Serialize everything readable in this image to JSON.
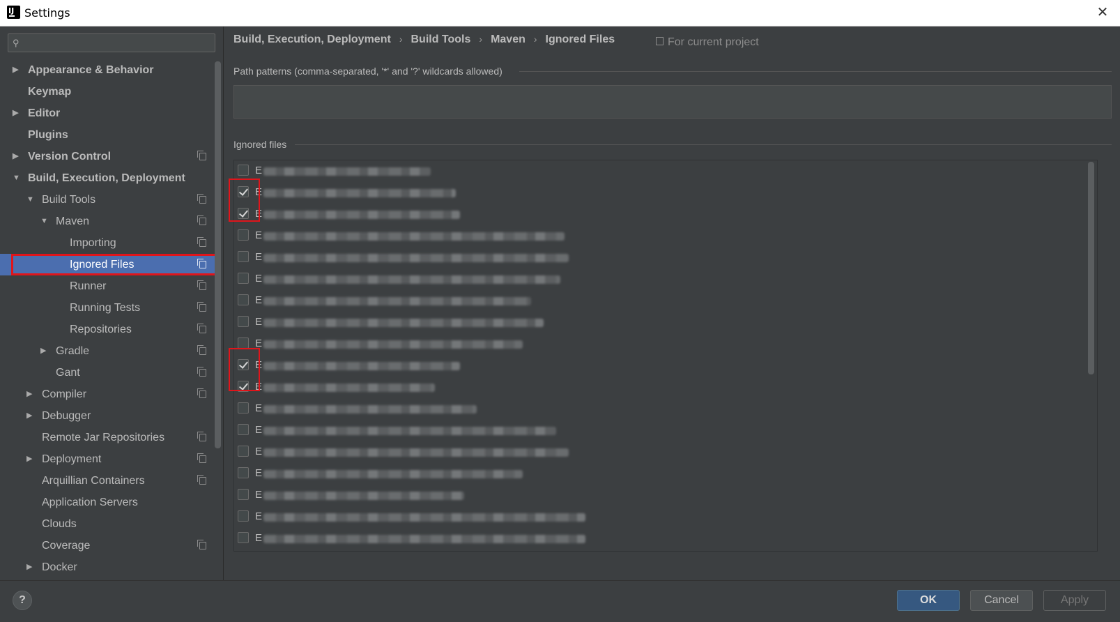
{
  "window": {
    "title": "Settings"
  },
  "search": {
    "placeholder": "",
    "value": ""
  },
  "sidebar": {
    "items": [
      {
        "label": "Appearance & Behavior",
        "level": 0,
        "arrow": "right",
        "bold": true,
        "project": false
      },
      {
        "label": "Keymap",
        "level": 0,
        "arrow": "",
        "bold": true,
        "project": false
      },
      {
        "label": "Editor",
        "level": 0,
        "arrow": "right",
        "bold": true,
        "project": false
      },
      {
        "label": "Plugins",
        "level": 0,
        "arrow": "",
        "bold": true,
        "project": false
      },
      {
        "label": "Version Control",
        "level": 0,
        "arrow": "right",
        "bold": true,
        "project": true
      },
      {
        "label": "Build, Execution, Deployment",
        "level": 0,
        "arrow": "down",
        "bold": true,
        "project": false
      },
      {
        "label": "Build Tools",
        "level": 1,
        "arrow": "down",
        "bold": false,
        "project": true
      },
      {
        "label": "Maven",
        "level": 2,
        "arrow": "down",
        "bold": false,
        "project": true
      },
      {
        "label": "Importing",
        "level": 3,
        "arrow": "",
        "bold": false,
        "project": true
      },
      {
        "label": "Ignored Files",
        "level": 3,
        "arrow": "",
        "bold": false,
        "project": true,
        "selected": true
      },
      {
        "label": "Runner",
        "level": 3,
        "arrow": "",
        "bold": false,
        "project": true
      },
      {
        "label": "Running Tests",
        "level": 3,
        "arrow": "",
        "bold": false,
        "project": true
      },
      {
        "label": "Repositories",
        "level": 3,
        "arrow": "",
        "bold": false,
        "project": true
      },
      {
        "label": "Gradle",
        "level": 2,
        "arrow": "right",
        "bold": false,
        "project": true
      },
      {
        "label": "Gant",
        "level": 2,
        "arrow": "",
        "bold": false,
        "project": true
      },
      {
        "label": "Compiler",
        "level": 1,
        "arrow": "right",
        "bold": false,
        "project": true
      },
      {
        "label": "Debugger",
        "level": 1,
        "arrow": "right",
        "bold": false,
        "project": false
      },
      {
        "label": "Remote Jar Repositories",
        "level": 1,
        "arrow": "",
        "bold": false,
        "project": true
      },
      {
        "label": "Deployment",
        "level": 1,
        "arrow": "right",
        "bold": false,
        "project": true
      },
      {
        "label": "Arquillian Containers",
        "level": 1,
        "arrow": "",
        "bold": false,
        "project": true
      },
      {
        "label": "Application Servers",
        "level": 1,
        "arrow": "",
        "bold": false,
        "project": false
      },
      {
        "label": "Clouds",
        "level": 1,
        "arrow": "",
        "bold": false,
        "project": false
      },
      {
        "label": "Coverage",
        "level": 1,
        "arrow": "",
        "bold": false,
        "project": true
      },
      {
        "label": "Docker",
        "level": 1,
        "arrow": "right",
        "bold": false,
        "project": false
      }
    ]
  },
  "breadcrumb": [
    "Build, Execution, Deployment",
    "Build Tools",
    "Maven",
    "Ignored Files"
  ],
  "scope_label": "For current project",
  "patterns": {
    "title": "Path patterns (comma-separated, '*' and '?' wildcards allowed)",
    "value": ""
  },
  "ignored": {
    "title": "Ignored files",
    "rows": [
      {
        "prefix": "E",
        "checked": false,
        "blur_width": 0.4
      },
      {
        "prefix": "E",
        "checked": true,
        "blur_width": 0.46
      },
      {
        "prefix": "E",
        "checked": true,
        "blur_width": 0.47
      },
      {
        "prefix": "E",
        "checked": false,
        "blur_width": 0.72
      },
      {
        "prefix": "E",
        "checked": false,
        "blur_width": 0.73
      },
      {
        "prefix": "E",
        "checked": false,
        "blur_width": 0.71
      },
      {
        "prefix": "E",
        "checked": false,
        "blur_width": 0.64
      },
      {
        "prefix": "E",
        "checked": false,
        "blur_width": 0.67
      },
      {
        "prefix": "E",
        "checked": false,
        "blur_width": 0.62
      },
      {
        "prefix": "E",
        "checked": true,
        "blur_width": 0.47
      },
      {
        "prefix": "E",
        "checked": true,
        "blur_width": 0.41
      },
      {
        "prefix": "E",
        "checked": false,
        "blur_width": 0.51
      },
      {
        "prefix": "E",
        "checked": false,
        "blur_width": 0.7
      },
      {
        "prefix": "E",
        "checked": false,
        "blur_width": 0.73
      },
      {
        "prefix": "E",
        "checked": false,
        "blur_width": 0.62
      },
      {
        "prefix": "E",
        "checked": false,
        "blur_width": 0.48
      },
      {
        "prefix": "E",
        "checked": false,
        "blur_width": 0.77
      },
      {
        "prefix": "E",
        "checked": false,
        "blur_width": 0.77
      },
      {
        "prefix": "E",
        "checked": false,
        "blur_width": 0.5
      }
    ]
  },
  "buttons": {
    "help": "?",
    "ok": "OK",
    "cancel": "Cancel",
    "apply": "Apply"
  },
  "colors": {
    "selection": "#4b6eaf",
    "annotation": "#e0151b",
    "ok_button": "#365880"
  },
  "icons": {
    "search": "search-icon",
    "close": "close-icon",
    "project_scope": "copy-icon"
  }
}
